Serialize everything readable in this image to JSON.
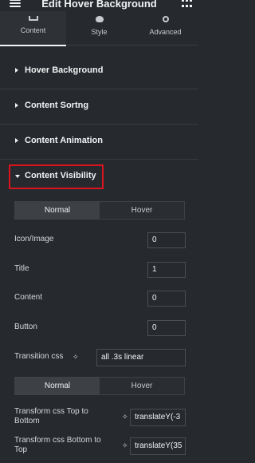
{
  "header": {
    "title": "Edit Hover Background"
  },
  "tabs": [
    {
      "label": "Content",
      "icon": "pencil-icon"
    },
    {
      "label": "Style",
      "icon": "half-circle-icon"
    },
    {
      "label": "Advanced",
      "icon": "gear-icon"
    }
  ],
  "sections": [
    {
      "label": "Hover Background",
      "state": "collapsed"
    },
    {
      "label": "Content Sortng",
      "state": "collapsed"
    },
    {
      "label": "Content Animation",
      "state": "collapsed"
    },
    {
      "label": "Content Visibility",
      "state": "expanded"
    }
  ],
  "visibility": {
    "toggle1": {
      "left": "Normal",
      "right": "Hover",
      "selected": "Normal"
    },
    "fields": [
      {
        "label": "Icon/Image",
        "value": "0"
      },
      {
        "label": "Title",
        "value": "1"
      },
      {
        "label": "Content",
        "value": "0"
      },
      {
        "label": "Button",
        "value": "0"
      }
    ],
    "transition": {
      "label": "Transition css",
      "value": "all .3s linear"
    },
    "toggle2": {
      "left": "Normal",
      "right": "Hover",
      "selected": "Normal"
    },
    "transform_top": {
      "label": "Transform css Top to Bottom",
      "value": "translateY(-3"
    },
    "transform_bottom": {
      "label": "Transform css Bottom to Top",
      "value": "translateY(35"
    }
  },
  "colors": {
    "panel_bg": "#26292d",
    "highlight_border": "#d9141f",
    "text": "#f1f3f5"
  }
}
